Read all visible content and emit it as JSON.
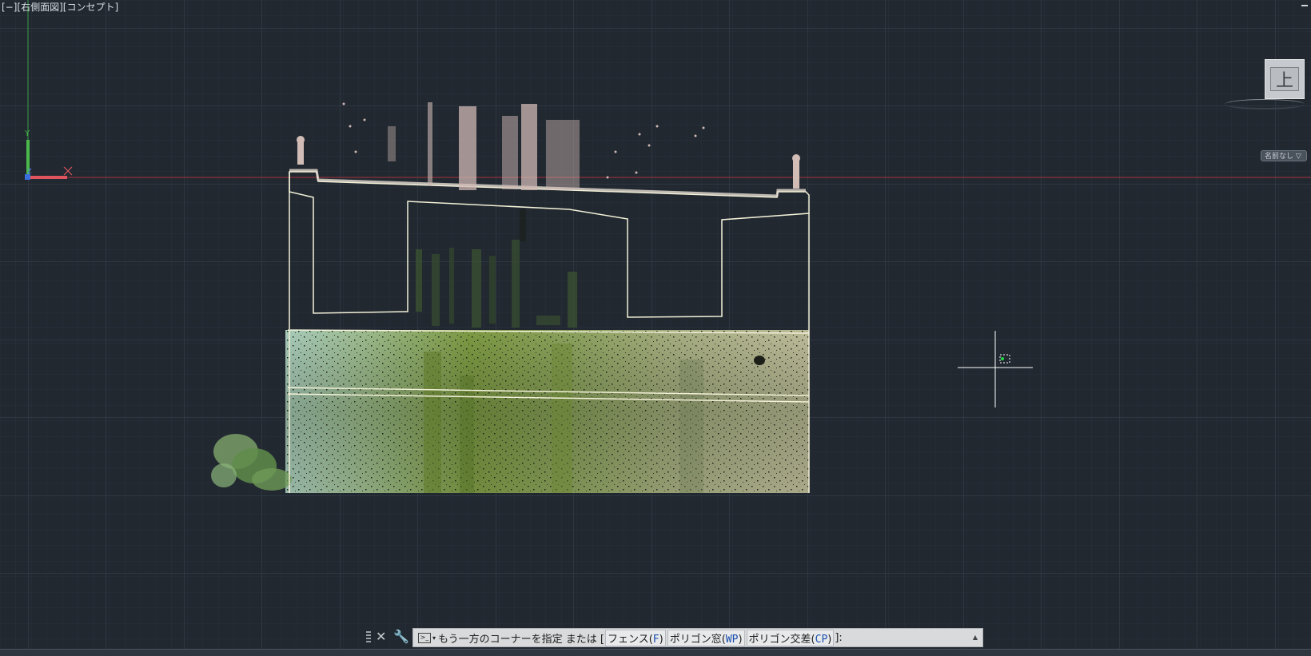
{
  "viewport": {
    "label": "[−][右側面図][コンセプト]",
    "axis_labels": {
      "y": "Y",
      "x": "X",
      "z": "Z"
    }
  },
  "viewcube": {
    "face": "上",
    "ucs_menu": "名前なし ▽"
  },
  "command_line": {
    "prompt": "もう一方のコーナーを指定 または [",
    "options": [
      {
        "label": "フェンス",
        "key": "F"
      },
      {
        "label": "ポリゴン窓",
        "key": "WP"
      },
      {
        "label": "ポリゴン交差",
        "key": "CP"
      }
    ],
    "suffix": "]:"
  },
  "colors": {
    "background": "#212830",
    "grid_minor": "#2a323c",
    "grid_major": "#3a434e",
    "x_axis": "#c0303a",
    "y_axis": "#3aa04a",
    "section_line": "#f3f1d8"
  },
  "icons": [
    "close-icon",
    "wrench-icon",
    "prompt-icon",
    "chevron-up-icon"
  ]
}
